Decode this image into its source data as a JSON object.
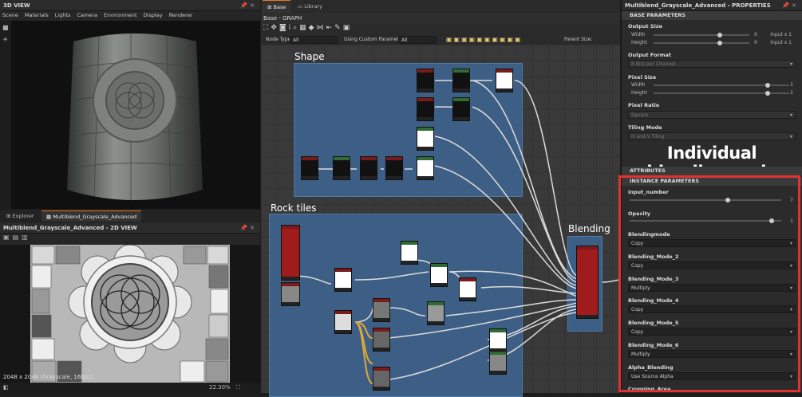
{
  "view3d": {
    "title": "3D VIEW",
    "menu": [
      "Scene",
      "Materials",
      "Lights",
      "Camera",
      "Environment",
      "Display",
      "Renderer"
    ]
  },
  "tabs2": [
    {
      "label": "Explorer"
    },
    {
      "label": "Multiblend_Grayscale_Advanced"
    }
  ],
  "view2d": {
    "title": "Multiblend_Grayscale_Advanced - 2D VIEW",
    "resolution": "2048 x 2048 (Grayscale, 16bpc)",
    "zoom": "22.30%"
  },
  "graph": {
    "tabs": [
      "Base",
      "Library"
    ],
    "title": "Base - GRAPH",
    "filter_node_type_label": "Node Type:",
    "filter_node_type_value": "All",
    "filter_custom_label": "Using Custom Parameters",
    "filter_custom_value": "All",
    "parent_size_label": "Parent Size:",
    "frames": {
      "shape": "Shape",
      "rock": "Rock tiles",
      "blending": "Blending"
    }
  },
  "props": {
    "title": "Multiblend_Grayscale_Advanced - PROPERTIES",
    "base_parameters": "BASE PARAMETERS",
    "output_size": "Output Size",
    "width": "Width",
    "height": "Height",
    "width_val": "0",
    "height_val": "0",
    "width_rel": "Input x 1",
    "height_rel": "Input x 1",
    "output_format": "Output Format",
    "output_format_val": "8 Bits per Channel",
    "pixel_size": "Pixel Size",
    "px_width_val": "1",
    "px_height_val": "1",
    "pixel_ratio": "Pixel Ratio",
    "pixel_ratio_val": "Square",
    "tiling_mode": "Tiling Mode",
    "tiling_mode_val": "H and V Tiling",
    "overlay_text": "Individual blendingmode",
    "attributes": "ATTRIBUTES",
    "instance_parameters": "INSTANCE PARAMETERS",
    "input_number": "input_number",
    "input_number_val": "7",
    "opacity": "Opacity",
    "opacity_val": "1",
    "blendingmode": "Blendingmode",
    "blendingmode_val": "Copy",
    "bm2": "Blending_Mode_2",
    "bm2_val": "Copy",
    "bm3": "Blending_Mode_3",
    "bm3_val": "Multiply",
    "bm4": "Blending_Mode_4",
    "bm4_val": "Copy",
    "bm5": "Blending_Mode_5",
    "bm5_val": "Copy",
    "bm6": "Blending_Mode_6",
    "bm6_val": "Multiply",
    "alpha_blending": "Alpha_Blending",
    "alpha_blending_val": "Use Source Alpha",
    "cropping_area": "Cropping_Area"
  }
}
